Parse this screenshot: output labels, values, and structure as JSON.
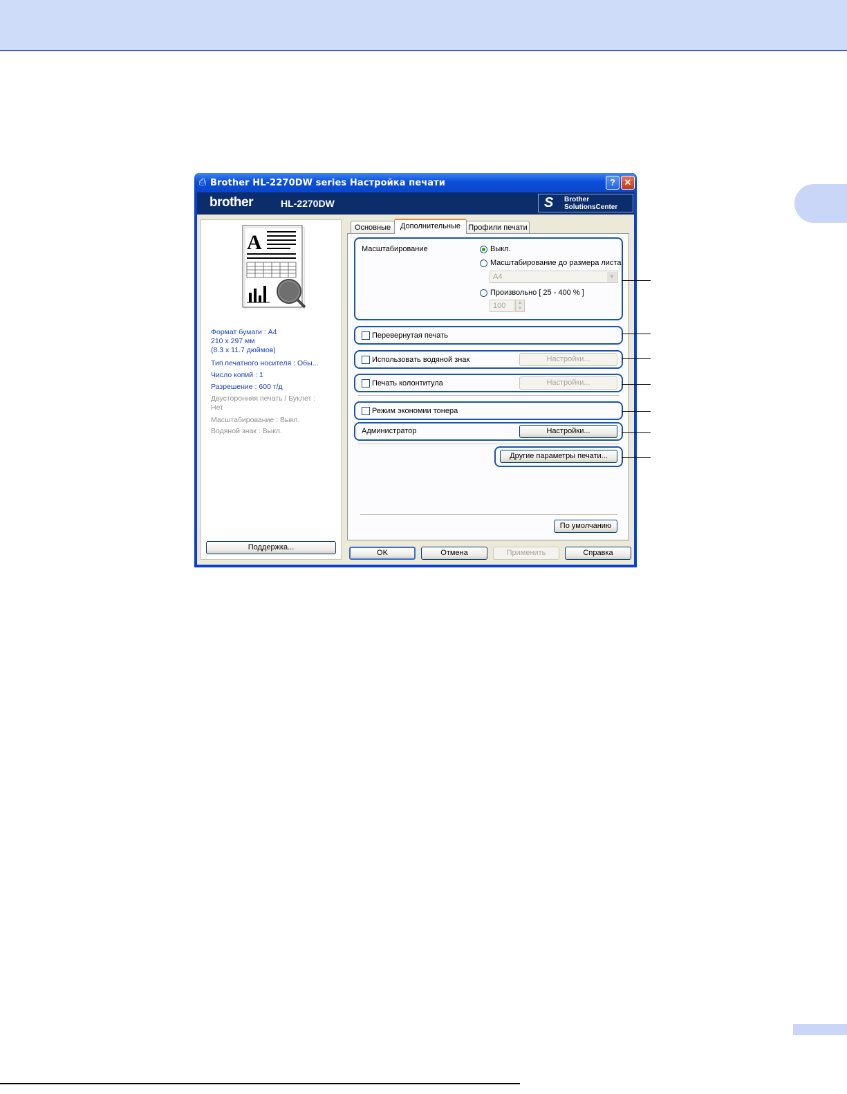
{
  "window": {
    "title": "Brother HL-2270DW series Настройка печати",
    "brand_logo": "brother",
    "model": "HL-2270DW",
    "solutions_line1": "Brother",
    "solutions_line2": "SolutionsCenter",
    "help_glyph": "?",
    "close_glyph": "✕"
  },
  "preview_page": {
    "letter": "A"
  },
  "summary": [
    "Формат бумаги : A4",
    "210 x 297 мм",
    "(8.3 x 11.7 дюймов)",
    "Тип печатного носителя : Обы...",
    "Число копий : 1",
    "Разрешение : 600 т/д",
    "Двусторонняя печать / Буклет :",
    "Нет",
    "Масштабирование : Выкл.",
    "Водяной знак : Выкл."
  ],
  "support_button": "Поддержка...",
  "tabs": [
    "Основные",
    "Дополнительные",
    "Профили печати"
  ],
  "active_tab": "Дополнительные",
  "scaling": {
    "label": "Масштабирование",
    "option_off": "Выкл.",
    "option_fit": "Масштабирование до размера листа",
    "fit_value": "A4",
    "option_free": "Произвольно [ 25 - 400 % ]",
    "free_value": "100",
    "selected": "Выкл."
  },
  "reverse_print": {
    "label": "Перевернутая печать",
    "checked": false
  },
  "watermark": {
    "label": "Использовать водяной знак",
    "checked": false,
    "settings": "Настройки..."
  },
  "header_footer": {
    "label": "Печать колонтитула",
    "checked": false,
    "settings": "Настройки..."
  },
  "toner_save": {
    "label": "Режим экономии тонера",
    "checked": false
  },
  "admin": {
    "label": "Администратор",
    "settings": "Настройки..."
  },
  "other_options_button": "Другие параметры печати...",
  "default_button": "По умолчанию",
  "bottom_buttons": {
    "ok": "OK",
    "cancel": "Отмена",
    "apply": "Применить",
    "help": "Справка"
  },
  "colors": {
    "titlebar": "#0b4fd9",
    "brandbar": "#0c2d6b",
    "callout": "#1a56a8",
    "summary_text": "#1a3fb8"
  }
}
